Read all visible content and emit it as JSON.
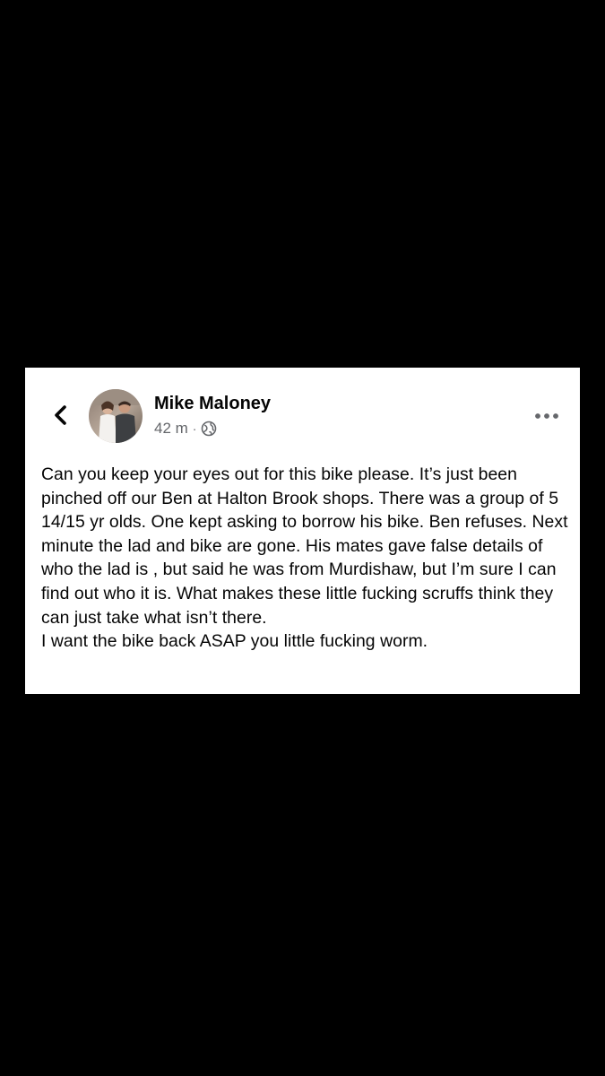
{
  "post": {
    "author": "Mike Maloney",
    "time": "42 m",
    "separator": "·",
    "privacy_icon": "globe-icon",
    "more_icon": "more-horizontal-icon",
    "back_icon": "chevron-left-icon",
    "paragraphs": [
      "Can you keep your eyes out for this bike please. It’s just been pinched off our Ben at Halton Brook shops. There was a group of 5 14/15 yr olds. One kept asking to borrow his bike. Ben refuses. Next minute the lad and bike are gone. His mates gave false details of who the lad is , but said he was from Murdishaw, but I’m sure I can find out who it is. What makes these little fucking scruffs think they can just take what isn’t there.",
      "I want the bike back ASAP you little fucking worm."
    ]
  },
  "colors": {
    "background": "#000000",
    "card": "#ffffff",
    "text": "#050505",
    "secondary_text": "#65676b"
  }
}
